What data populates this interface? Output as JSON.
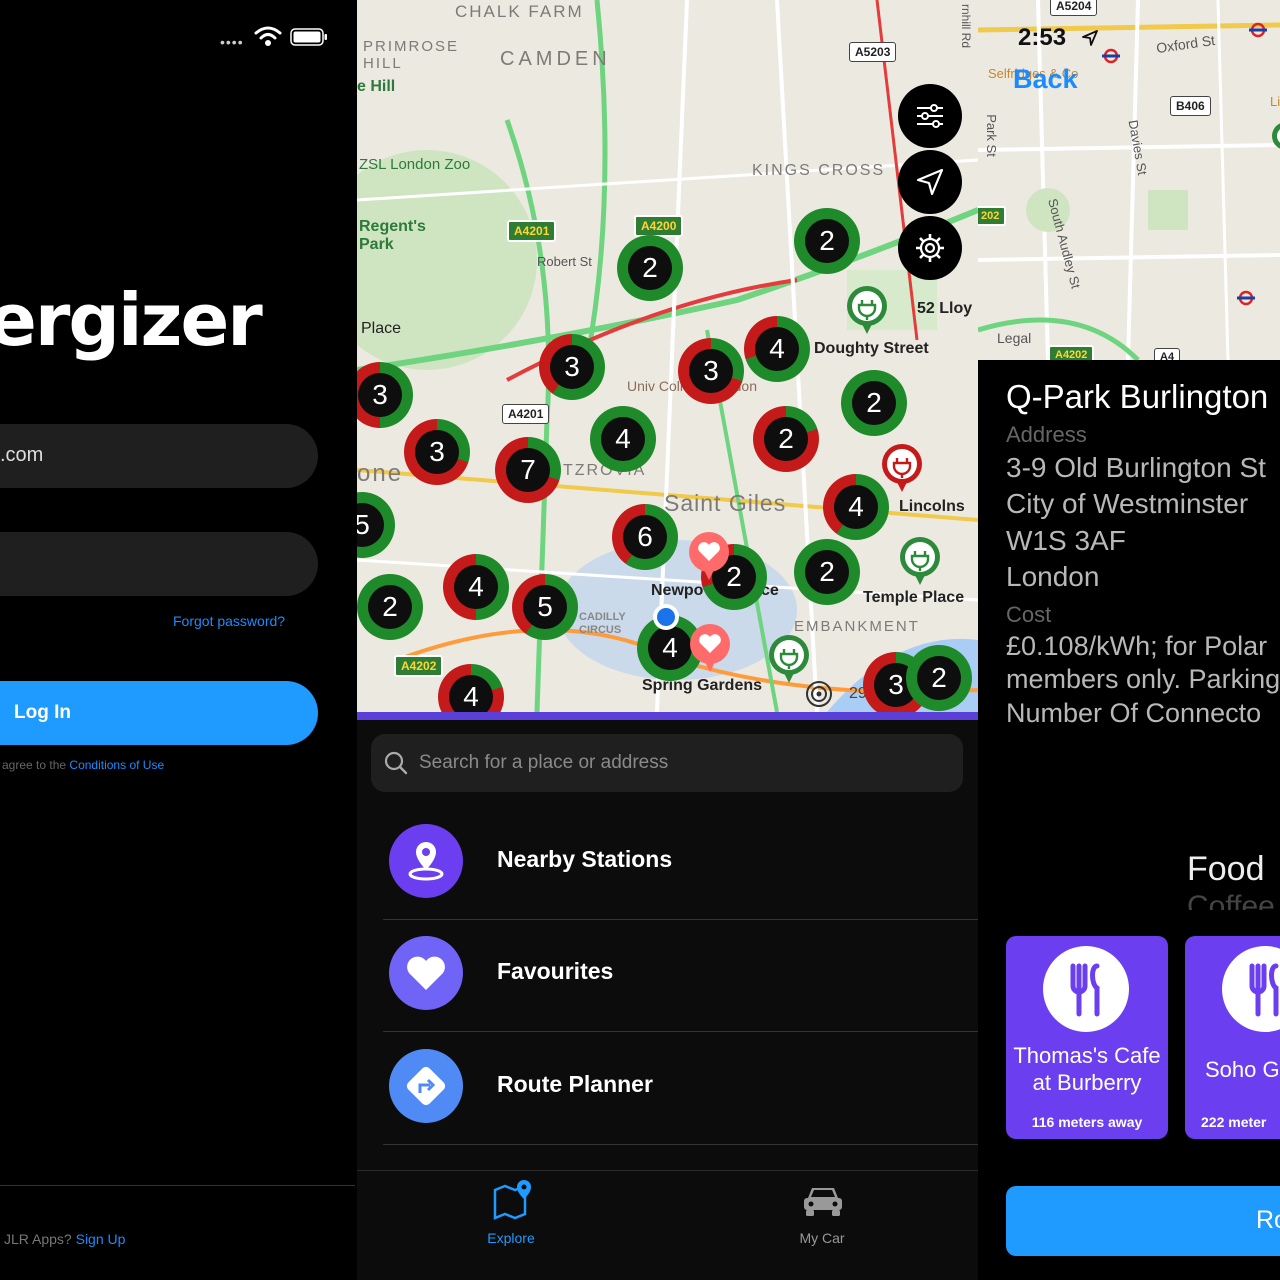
{
  "login": {
    "status_dots": "••••",
    "brand": "ergizer",
    "email_value": ".com",
    "forgot_password": "Forgot password?",
    "login_button": "Log In",
    "terms_prefix": "agree to the",
    "terms_link": "Conditions of Use",
    "signup_prefix": "JLR Apps?",
    "signup_link": "Sign Up"
  },
  "explore": {
    "map_labels": {
      "chalk_farm": "CHALK FARM",
      "primrose_hill": "PRIMROSE HILL",
      "camden": "CAMDEN",
      "e_hill": "e Hill",
      "zoo": "ZSL London Zoo",
      "regents_park": "Regent's Park",
      "place": "Place",
      "kings_cross": "KINGS CROSS",
      "robert_st": "Robert St",
      "univ": "Univ College London",
      "one": "one",
      "fitzrovia": "TZROVIA",
      "saint_giles": "Saint Giles",
      "lloy": "52 Lloy",
      "doughty": "Doughty Street",
      "lincolns": "Lincolns",
      "newport": "Newpo",
      "ce": "ce",
      "temple": "Temple Place",
      "embankment": "EMBANKMENT",
      "piccadilly": "CADILLY CIRCUS",
      "spring": "Spring Gardens",
      "miles": "29.5 miles",
      "rd": "rnhill Rd"
    },
    "road_shields": [
      "A5203",
      "A4201",
      "A4200",
      "A4201",
      "A4202"
    ],
    "clusters": [
      {
        "count": "2",
        "green": 1.0
      },
      {
        "count": "2",
        "green": 1.0
      },
      {
        "count": "3",
        "green": 0.5
      },
      {
        "count": "3",
        "green": 0.6
      },
      {
        "count": "4",
        "green": 0.7
      },
      {
        "count": "3",
        "green": 0.3
      },
      {
        "count": "3",
        "green": 0.3
      },
      {
        "count": "7",
        "green": 0.3
      },
      {
        "count": "4",
        "green": 1.0
      },
      {
        "count": "2",
        "green": 0.2
      },
      {
        "count": "2",
        "green": 1.0
      },
      {
        "count": "4",
        "green": 0.6
      },
      {
        "count": "6",
        "green": 0.6
      },
      {
        "count": "5",
        "green": 1.0
      },
      {
        "count": "2",
        "green": 1.0
      },
      {
        "count": "4",
        "green": 0.5
      },
      {
        "count": "5",
        "green": 0.6
      },
      {
        "count": "2",
        "green": 0.7
      },
      {
        "count": "2",
        "green": 1.0
      },
      {
        "count": "4",
        "green": 1.0
      },
      {
        "count": "4",
        "green": 0.2
      },
      {
        "count": "3",
        "green": 0.3
      },
      {
        "count": "2",
        "green": 1.0
      }
    ],
    "search_placeholder": "Search for a place or address",
    "menu": [
      {
        "label": "Nearby Stations",
        "color": "#6b3ff0"
      },
      {
        "label": "Favourites",
        "color": "#6f64f5"
      },
      {
        "label": "Route Planner",
        "color": "#4f8af5"
      }
    ],
    "tabs": {
      "explore": "Explore",
      "my_car": "My Car"
    },
    "colors": {
      "active_tab": "#1f9aff",
      "inactive_tab": "#999999",
      "cluster_green": "#1e8a2a",
      "cluster_red": "#c41a1a"
    }
  },
  "detail": {
    "time": "2:53",
    "back": "Back",
    "map_labels": {
      "a5204": "A5204",
      "oxford_st": "Oxford St",
      "selfridges": "Selfridges & Co",
      "b406": "B406",
      "park_st": "Park St",
      "davies_st": "Davies St",
      "south_audley": "South Audley St",
      "legal": "Legal",
      "a4202": "A4202",
      "a4": "A4",
      "n202": "202",
      "li": "Li"
    },
    "station_name": "Q-Park Burlington",
    "address_label": "Address",
    "address_lines": [
      "3-9 Old Burlington St",
      "City of Westminster",
      "W1S 3AF",
      "London"
    ],
    "cost_label": "Cost",
    "cost_lines": [
      "£0.108/kWh; for Polar",
      "members only. Parking",
      "Number Of Connecto"
    ],
    "food_title": "Food",
    "food_sub": "Coffee",
    "cards": [
      {
        "name": "Thomas's Cafe at Burberry",
        "distance": "116 meters away"
      },
      {
        "name": "Soho G",
        "distance": "222 meter"
      }
    ],
    "route_button": "Ro"
  }
}
